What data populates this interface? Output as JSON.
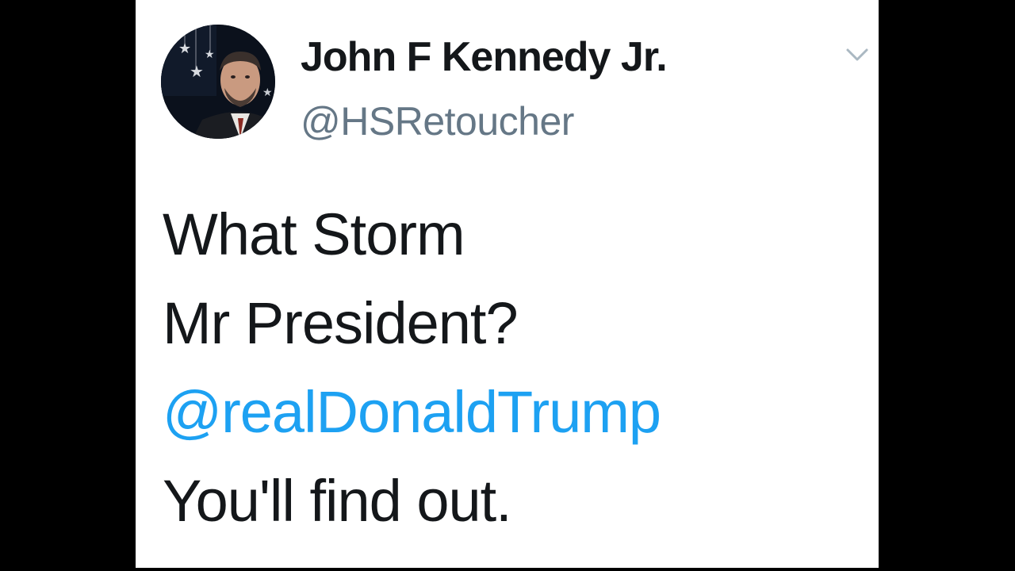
{
  "tweet": {
    "author": {
      "display_name": "John F Kennedy Jr.",
      "handle": "@HSRetoucher",
      "avatar_icon": "profile-photo"
    },
    "menu_icon": "chevron-down-icon",
    "text_lines": [
      "What Storm",
      "Mr President?",
      "@realDonaldTrump",
      "You'll find out."
    ],
    "mention_color": "#1da1f2",
    "text_color": "#14171a",
    "handle_color": "#657786"
  }
}
